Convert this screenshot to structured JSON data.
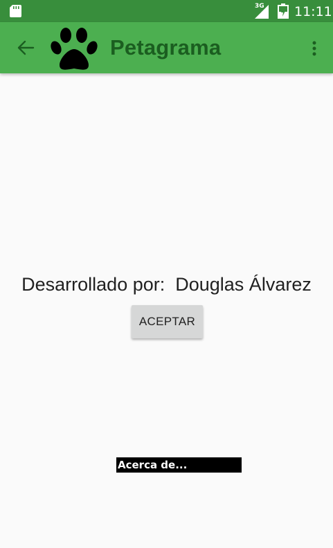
{
  "status_bar": {
    "network_type": "3G",
    "time": "11:11",
    "icons": [
      "sd-card-icon",
      "signal-icon",
      "battery-icon"
    ]
  },
  "app_bar": {
    "title": "Petagrama",
    "icons": [
      "back-arrow-icon",
      "paw-icon",
      "overflow-menu-icon"
    ]
  },
  "content": {
    "developer_text": "Desarrollado por:  Douglas Álvarez",
    "accept_label": "ACEPTAR",
    "about_label": "Acerca de..."
  },
  "colors": {
    "status_bar": "#388e3c",
    "app_bar": "#4caf50",
    "title": "#1b5e20",
    "background": "#fafafa",
    "button": "#d6d7d7"
  }
}
